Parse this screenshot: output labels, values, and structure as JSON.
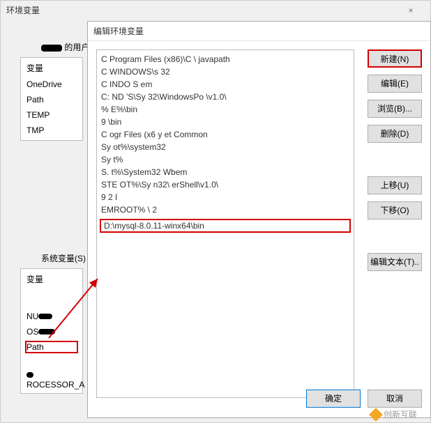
{
  "parent_window": {
    "title": "环境变量",
    "user_section_label": "的用户变量",
    "user_header": "变量",
    "user_vars": [
      "OneDrive",
      "Path",
      "TEMP",
      "TMP"
    ],
    "sys_section_label": "系统变量(S)",
    "sys_header": "变量",
    "sys_vars": [
      "NU",
      "OS",
      "Path"
    ],
    "processor_label": "ROCESSOR_A"
  },
  "edit_window": {
    "title": "编辑环境变量",
    "path_entries": [
      "C  Program Files (x86)\\C                                       \\ javapath",
      "C  WINDOWS\\s           32",
      "C    INDO  S                          em",
      "C:    ND    'S\\Sy         32\\WindowsPo             \\v1.0\\",
      "%                   E%\\bin",
      "9                       \\bin",
      "C      ogr     Files (x6                                            y et Common",
      "  Sy        ot%\\system32",
      " Sy         t%",
      " S.             t%\\System32  Wbem",
      "     STE     OT%\\Sy       n32\\                    erShell\\v1.0\\",
      "9     2    I",
      "         EMROOT% \\ 2"
    ],
    "highlighted_entry": "D:\\mysql-8.0.11-winx64\\bin",
    "buttons": {
      "new": "新建(N)",
      "edit": "编辑(E)",
      "browse": "浏览(B)...",
      "delete": "删除(D)",
      "moveup": "上移(U)",
      "movedown": "下移(O)",
      "edittext": "编辑文本(T)..",
      "ok": "确定",
      "cancel": "取消"
    }
  },
  "watermark": "创新互联"
}
